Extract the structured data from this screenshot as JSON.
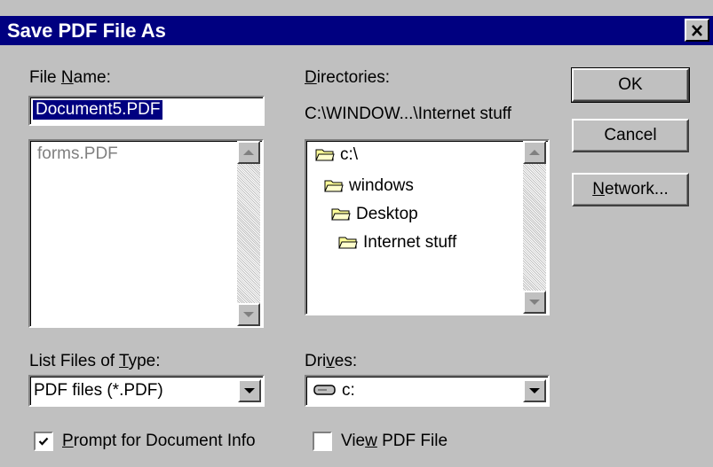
{
  "window": {
    "title": "Save PDF File As"
  },
  "file_name": {
    "label_pre": "File ",
    "label_key": "N",
    "label_post": "ame:",
    "value": "Document5.PDF"
  },
  "file_list": {
    "items": [
      "forms.PDF"
    ]
  },
  "directories": {
    "label_key": "D",
    "label_post": "irectories:",
    "current_path": "C:\\WINDOW...\\Internet stuff",
    "tree": [
      "c:\\",
      "windows",
      "Desktop",
      "Internet stuff"
    ]
  },
  "buttons": {
    "ok": "OK",
    "cancel": "Cancel",
    "network_key": "N",
    "network_post": "etwork..."
  },
  "file_type": {
    "label_pre": "List Files of ",
    "label_key": "T",
    "label_post": "ype:",
    "selected": "PDF files (*.PDF)"
  },
  "drives": {
    "label_pre": "Dri",
    "label_key": "v",
    "label_post": "es:",
    "selected": "c:"
  },
  "options": {
    "prompt_doc_info": {
      "key": "P",
      "rest": "rompt for Document Info",
      "checked": true
    },
    "view_pdf": {
      "pre": "Vie",
      "key": "w",
      "rest": " PDF File",
      "checked": false
    }
  },
  "colors": {
    "titlebar": "#000080",
    "face": "#c0c0c0",
    "selection": "#000080",
    "folder": "#ffff99"
  },
  "icons": {
    "close": "close-icon",
    "folder": "folder-open-icon",
    "drive": "drive-icon",
    "check": "check-icon"
  }
}
